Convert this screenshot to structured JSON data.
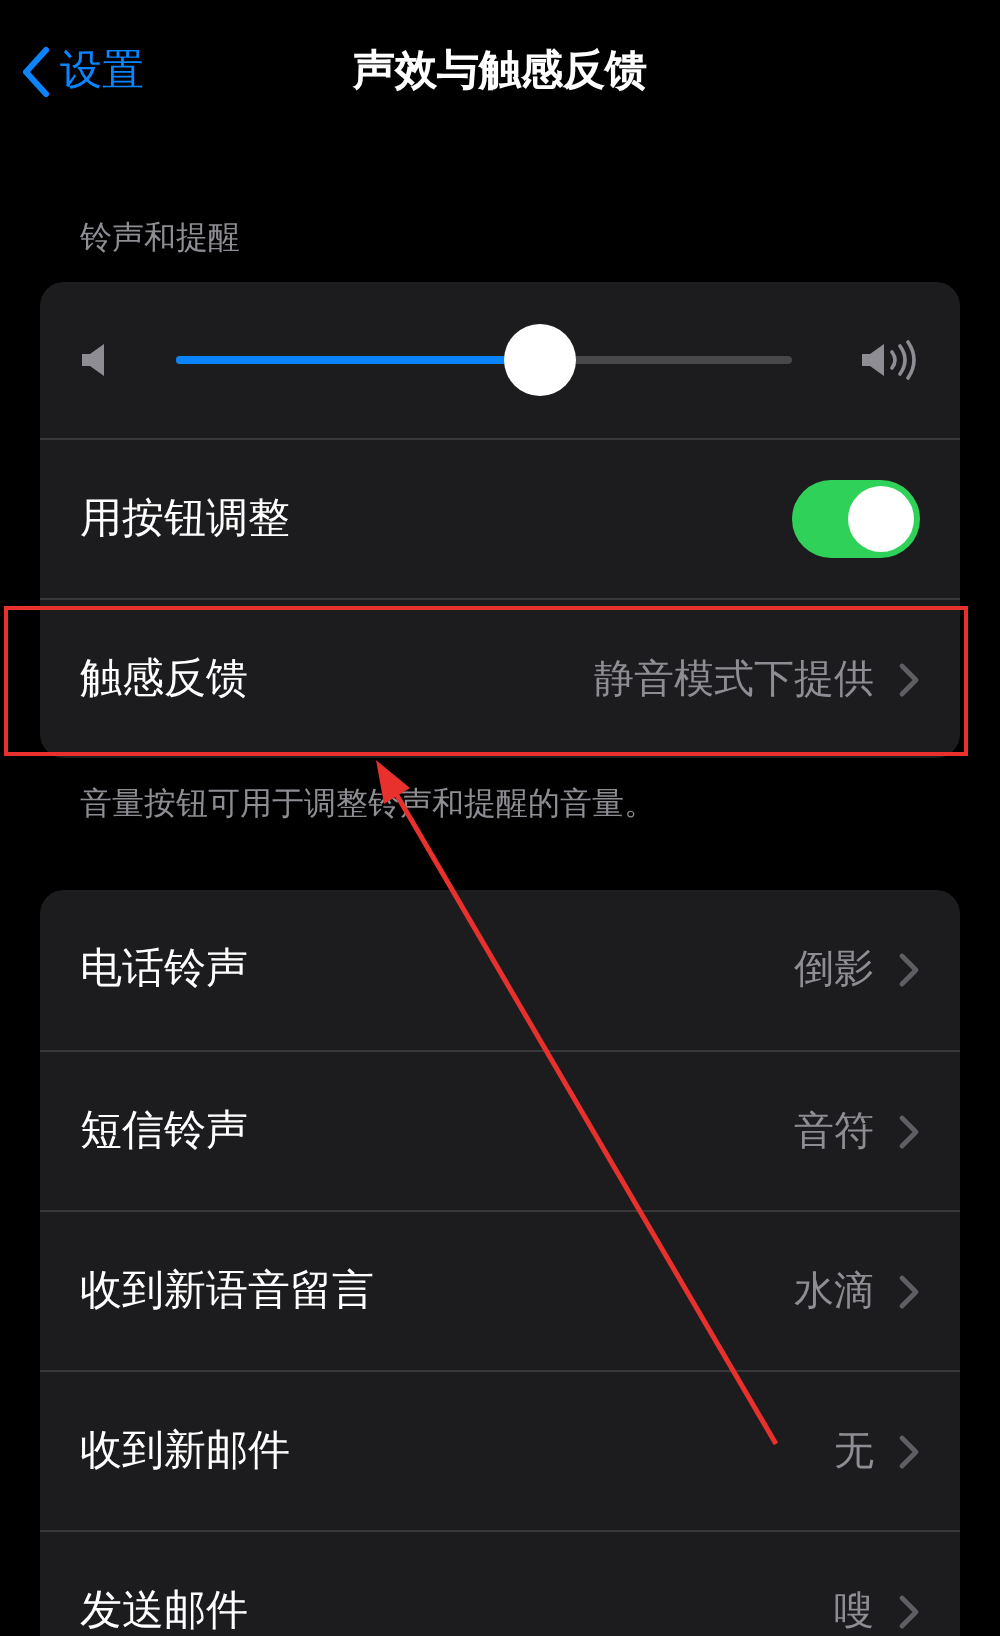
{
  "nav": {
    "back": "设置",
    "title": "声效与触感反馈"
  },
  "ringer_section": {
    "header": "铃声和提醒",
    "volume": {
      "level": 0.59
    },
    "rows": [
      {
        "kind": "toggle",
        "label": "用按钮调整",
        "on": true,
        "highlighted": false
      },
      {
        "kind": "link",
        "label": "触感反馈",
        "value": "静音模式下提供",
        "highlighted": true
      }
    ],
    "footer": "音量按钮可用于调整铃声和提醒的音量。"
  },
  "sounds": [
    {
      "label": "电话铃声",
      "value": "倒影"
    },
    {
      "label": "短信铃声",
      "value": "音符"
    },
    {
      "label": "收到新语音留言",
      "value": "水滴"
    },
    {
      "label": "收到新邮件",
      "value": "无"
    },
    {
      "label": "发送邮件",
      "value": "嗖"
    }
  ]
}
